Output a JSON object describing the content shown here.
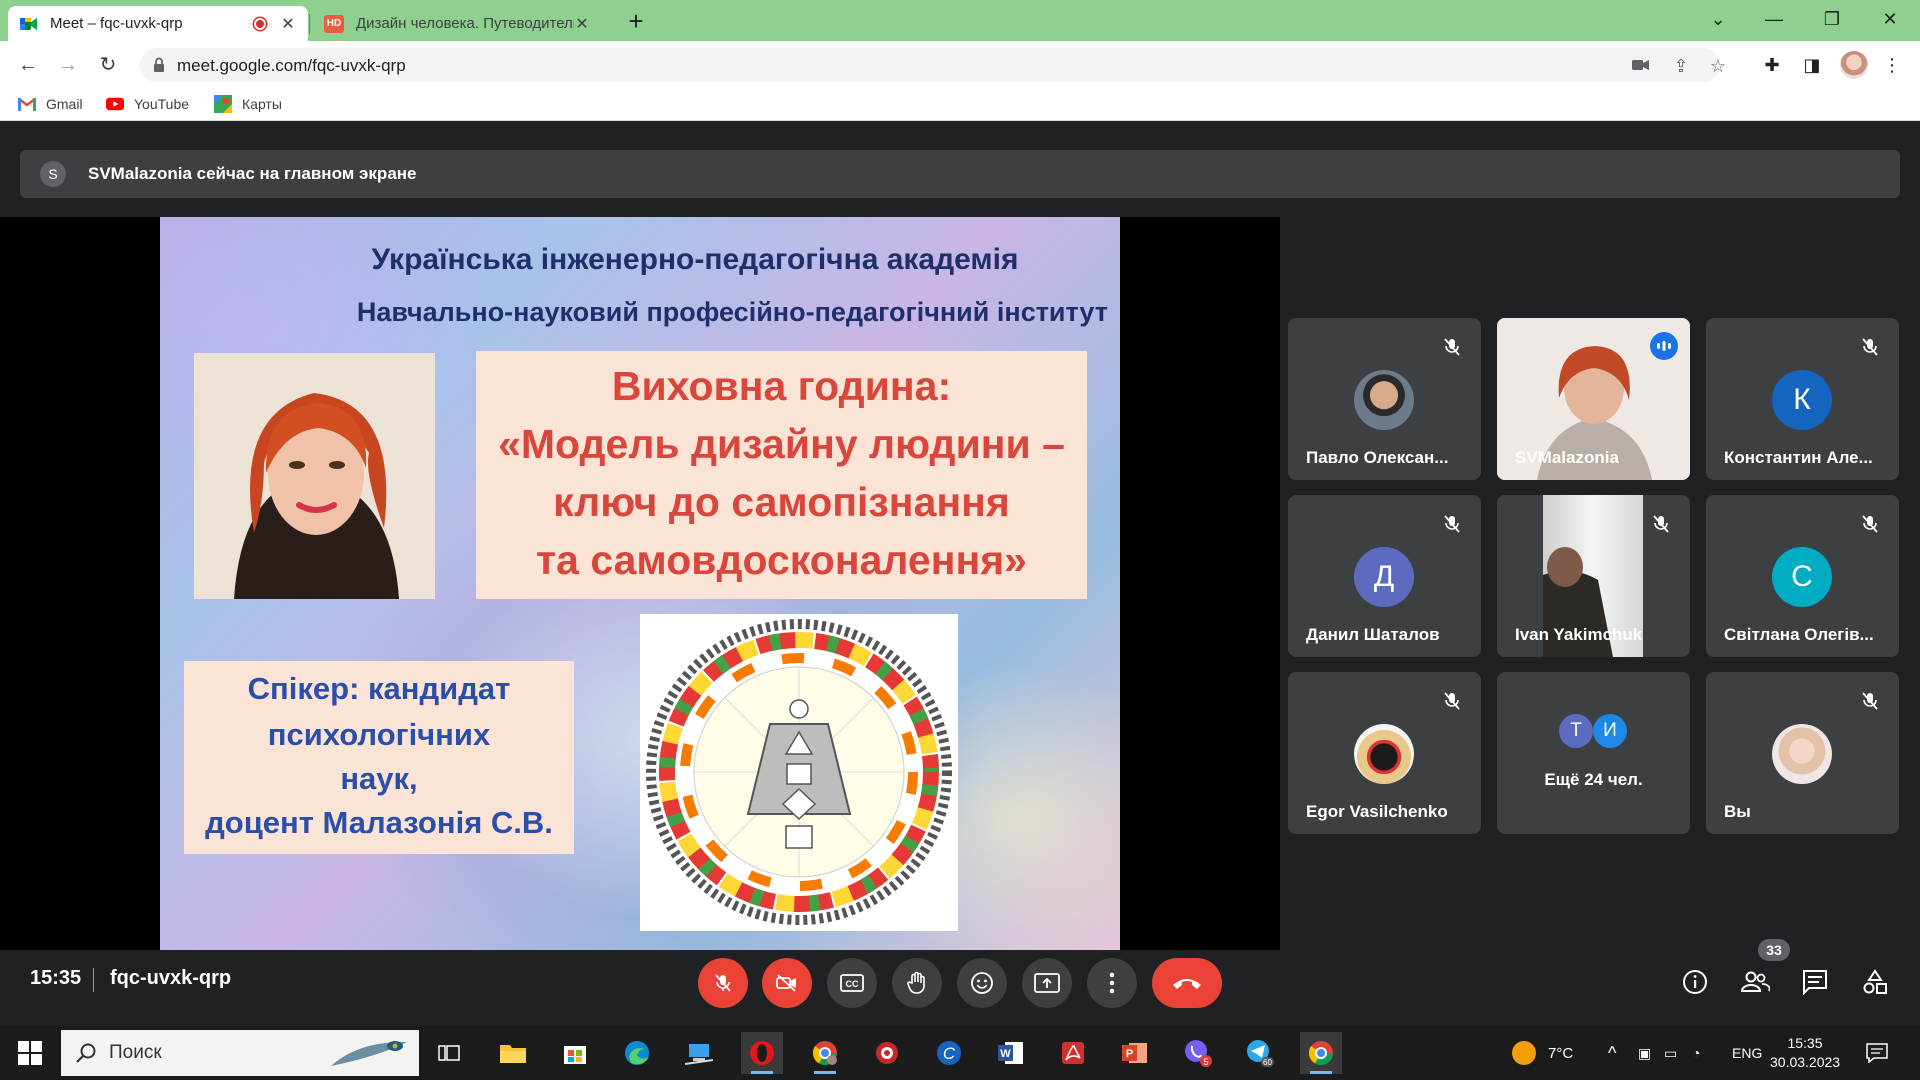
{
  "browser": {
    "tabs": [
      {
        "title": "Meet – fqc-uvxk-qrp",
        "active": true
      },
      {
        "title": "Дизайн человека. Путеводитель",
        "active": false
      }
    ],
    "favicon_hd": "HD",
    "url": "meet.google.com/fqc-uvxk-qrp",
    "bookmarks": [
      {
        "label": "Gmail",
        "icon": "gmail-icon"
      },
      {
        "label": "YouTube",
        "icon": "youtube-icon"
      },
      {
        "label": "Карты",
        "icon": "maps-icon"
      }
    ]
  },
  "meet": {
    "banner": {
      "avatar_letter": "S",
      "text": "SVMalazonia сейчас на главном экране"
    },
    "slide": {
      "header_line1": "Українська інженерно-педагогічна академія",
      "header_line2": "Навчально-науковий професійно-педагогічний інститут",
      "title_lines": [
        "Виховна година:",
        "«Модель дизайну людини –",
        "ключ до самопізнання",
        "та самовдосконалення»"
      ],
      "speaker_lines": [
        "Спікер: кандидат",
        "психологічних",
        "наук,",
        "доцент Малазонія С.В."
      ]
    },
    "participants": [
      {
        "name": "Павло Олексан...",
        "muted": true,
        "avatar_type": "photo"
      },
      {
        "name": "SVMalazonia",
        "muted": false,
        "speaking": true,
        "avatar_type": "video"
      },
      {
        "name": "Константин Але...",
        "muted": true,
        "avatar_type": "letter",
        "letter": "К",
        "color": "#1565c0"
      },
      {
        "name": "Данил Шаталов",
        "muted": true,
        "avatar_type": "letter",
        "letter": "Д",
        "color": "#5c6bc0"
      },
      {
        "name": "Ivan Yakimchuk",
        "muted": true,
        "avatar_type": "video"
      },
      {
        "name": "Світлана Олегів...",
        "muted": true,
        "avatar_type": "letter",
        "letter": "С",
        "color": "#00acc1"
      },
      {
        "name": "Egor Vasilchenko",
        "muted": true,
        "avatar_type": "photo"
      },
      {
        "name": "Ещё 24 чел.",
        "muted": false,
        "avatar_type": "group",
        "letters": [
          "Т",
          "И"
        ]
      },
      {
        "name": "Вы",
        "muted": true,
        "avatar_type": "photo"
      }
    ],
    "controls": {
      "time": "15:35",
      "meeting_code": "fqc-uvxk-qrp",
      "participants_count": "33"
    }
  },
  "taskbar": {
    "search_placeholder": "Поиск",
    "weather": "7°C",
    "language": "ENG",
    "time": "15:35",
    "date": "30.03.2023",
    "badges": {
      "viber": "5",
      "telegram": "60"
    }
  },
  "colors": {
    "tabstrip": "#8fcf8f",
    "meet_bg": "#202124",
    "tile_bg": "#3c4043",
    "danger": "#ea4335",
    "speaking_outline": "#8ab4f8"
  }
}
